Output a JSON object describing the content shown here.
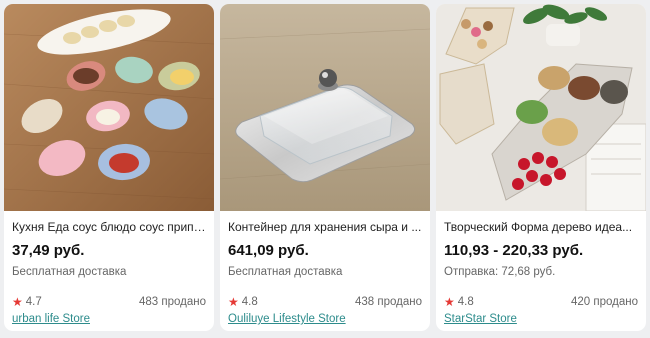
{
  "products": [
    {
      "title": "Кухня Еда соус блюдо соус припр...",
      "price": "37,49 руб.",
      "shipping": "Бесплатная доставка",
      "rating": "4.7",
      "sold": "483 продано",
      "store": "urban life Store",
      "image": "pastel-leaf-sauce-dishes"
    },
    {
      "title": "Контейнер для хранения сыра и ...",
      "price": "641,09 руб.",
      "shipping": "Бесплатная доставка",
      "rating": "4.8",
      "sold": "438 продано",
      "store": "Ouliluye Lifestyle Store",
      "image": "butter-dish-glass-lid"
    },
    {
      "title": "Творческий Форма дерево идеа...",
      "price": "110,93 - 220,33 руб.",
      "shipping": "Отправка: 72,68 руб.",
      "rating": "4.8",
      "sold": "420 продано",
      "store": "StarStar Store",
      "image": "christmas-tree-snack-tray"
    }
  ],
  "icons": {
    "rating": "star-icon"
  },
  "colors": {
    "star": "#e53935",
    "store_link": "#2d8c8c",
    "background": "#eeeff1"
  }
}
